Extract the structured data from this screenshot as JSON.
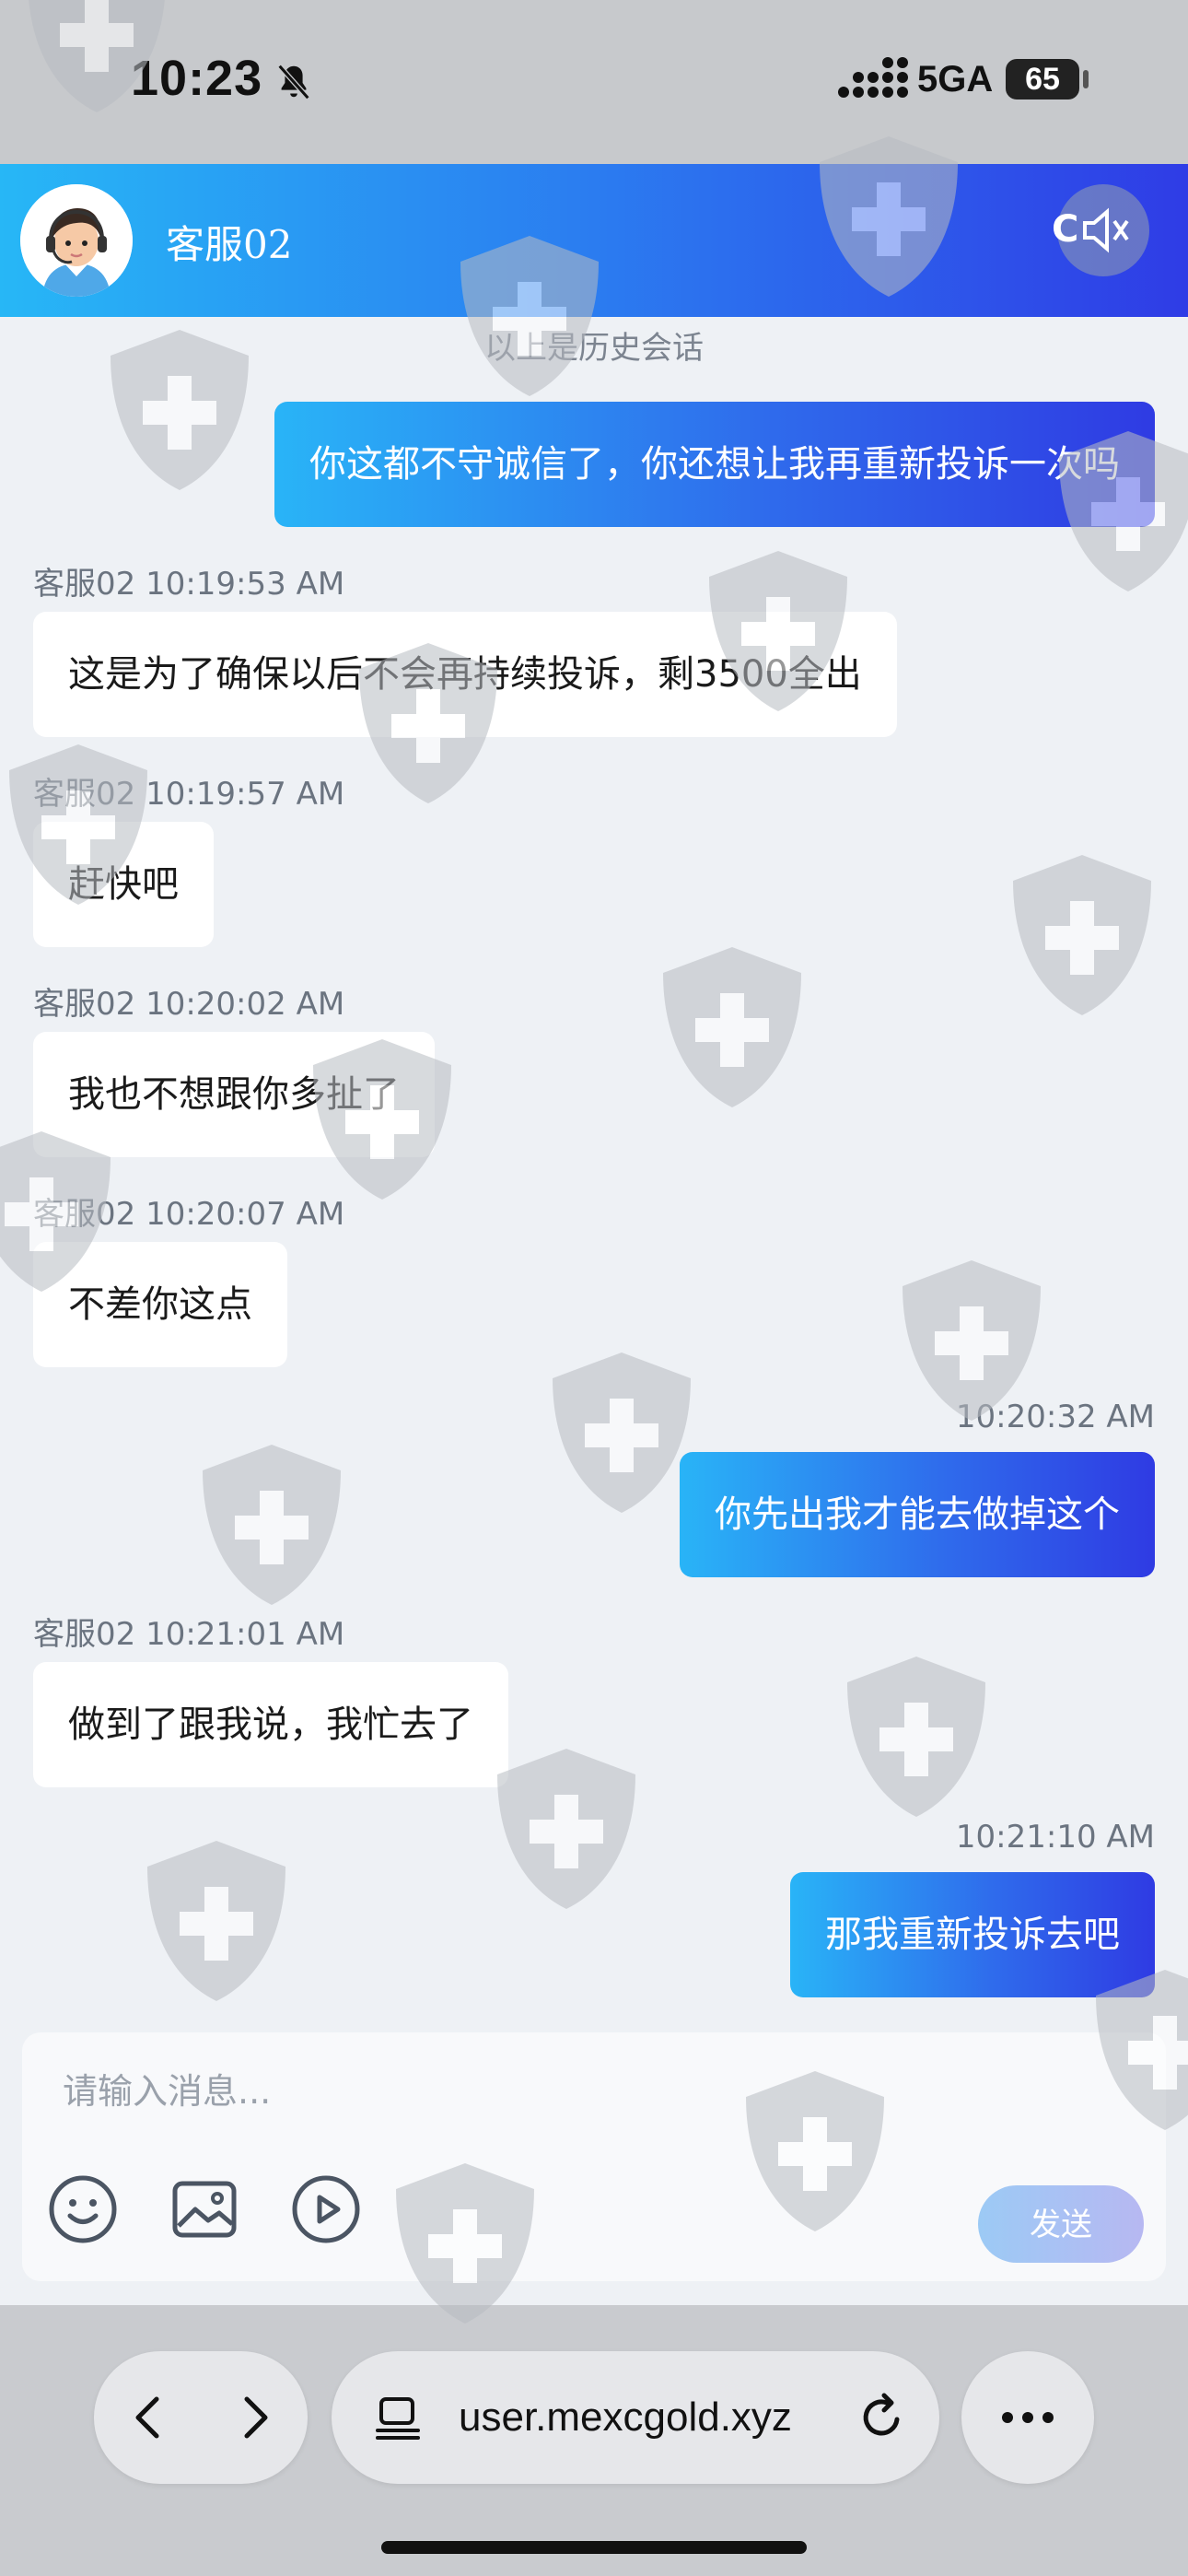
{
  "status_bar": {
    "time": "10:23",
    "network": "5GA",
    "battery": "65"
  },
  "header": {
    "agent_name": "客服02",
    "close_label": "C"
  },
  "history_note": "以上是历史会话",
  "messages": [
    {
      "side": "out",
      "meta": "",
      "text": "你这都不守诚信了，你还想让我再重新投诉一次吗"
    },
    {
      "side": "in",
      "meta": "客服02 10:19:53 AM",
      "text": "这是为了确保以后不会再持续投诉，剩3500全出"
    },
    {
      "side": "in",
      "meta": "客服02 10:19:57 AM",
      "text": "赶快吧"
    },
    {
      "side": "in",
      "meta": "客服02 10:20:02 AM",
      "text": "我也不想跟你多扯了"
    },
    {
      "side": "in",
      "meta": "客服02 10:20:07 AM",
      "text": "不差你这点"
    },
    {
      "side": "out",
      "meta": "10:20:32 AM",
      "text": "你先出我才能去做掉这个"
    },
    {
      "side": "in",
      "meta": "客服02 10:21:01 AM",
      "text": "做到了跟我说，我忙去了"
    },
    {
      "side": "out",
      "meta": "10:21:10 AM",
      "text": "那我重新投诉去吧"
    }
  ],
  "composer": {
    "placeholder": "请输入消息...",
    "send_label": "发送"
  },
  "browser": {
    "url": "user.mexcgold.xyz"
  }
}
